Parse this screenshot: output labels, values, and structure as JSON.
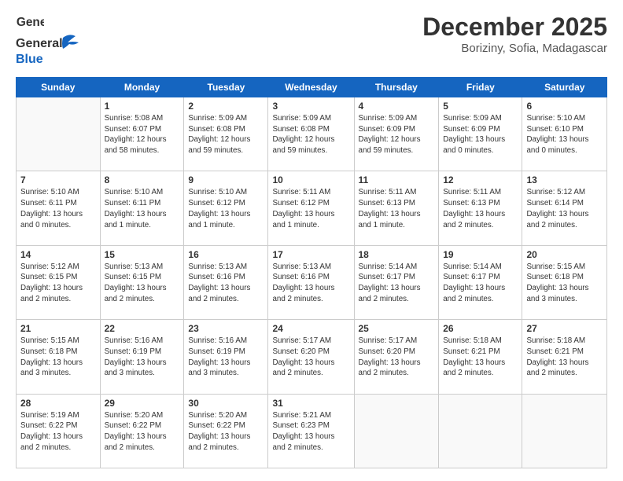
{
  "logo": {
    "line1": "General",
    "line2": "Blue"
  },
  "title": "December 2025",
  "subtitle": "Boriziny, Sofia, Madagascar",
  "days_header": [
    "Sunday",
    "Monday",
    "Tuesday",
    "Wednesday",
    "Thursday",
    "Friday",
    "Saturday"
  ],
  "weeks": [
    [
      {
        "day": "",
        "info": ""
      },
      {
        "day": "1",
        "info": "Sunrise: 5:08 AM\nSunset: 6:07 PM\nDaylight: 12 hours\nand 58 minutes."
      },
      {
        "day": "2",
        "info": "Sunrise: 5:09 AM\nSunset: 6:08 PM\nDaylight: 12 hours\nand 59 minutes."
      },
      {
        "day": "3",
        "info": "Sunrise: 5:09 AM\nSunset: 6:08 PM\nDaylight: 12 hours\nand 59 minutes."
      },
      {
        "day": "4",
        "info": "Sunrise: 5:09 AM\nSunset: 6:09 PM\nDaylight: 12 hours\nand 59 minutes."
      },
      {
        "day": "5",
        "info": "Sunrise: 5:09 AM\nSunset: 6:09 PM\nDaylight: 13 hours\nand 0 minutes."
      },
      {
        "day": "6",
        "info": "Sunrise: 5:10 AM\nSunset: 6:10 PM\nDaylight: 13 hours\nand 0 minutes."
      }
    ],
    [
      {
        "day": "7",
        "info": "Sunrise: 5:10 AM\nSunset: 6:11 PM\nDaylight: 13 hours\nand 0 minutes."
      },
      {
        "day": "8",
        "info": "Sunrise: 5:10 AM\nSunset: 6:11 PM\nDaylight: 13 hours\nand 1 minute."
      },
      {
        "day": "9",
        "info": "Sunrise: 5:10 AM\nSunset: 6:12 PM\nDaylight: 13 hours\nand 1 minute."
      },
      {
        "day": "10",
        "info": "Sunrise: 5:11 AM\nSunset: 6:12 PM\nDaylight: 13 hours\nand 1 minute."
      },
      {
        "day": "11",
        "info": "Sunrise: 5:11 AM\nSunset: 6:13 PM\nDaylight: 13 hours\nand 1 minute."
      },
      {
        "day": "12",
        "info": "Sunrise: 5:11 AM\nSunset: 6:13 PM\nDaylight: 13 hours\nand 2 minutes."
      },
      {
        "day": "13",
        "info": "Sunrise: 5:12 AM\nSunset: 6:14 PM\nDaylight: 13 hours\nand 2 minutes."
      }
    ],
    [
      {
        "day": "14",
        "info": "Sunrise: 5:12 AM\nSunset: 6:15 PM\nDaylight: 13 hours\nand 2 minutes."
      },
      {
        "day": "15",
        "info": "Sunrise: 5:13 AM\nSunset: 6:15 PM\nDaylight: 13 hours\nand 2 minutes."
      },
      {
        "day": "16",
        "info": "Sunrise: 5:13 AM\nSunset: 6:16 PM\nDaylight: 13 hours\nand 2 minutes."
      },
      {
        "day": "17",
        "info": "Sunrise: 5:13 AM\nSunset: 6:16 PM\nDaylight: 13 hours\nand 2 minutes."
      },
      {
        "day": "18",
        "info": "Sunrise: 5:14 AM\nSunset: 6:17 PM\nDaylight: 13 hours\nand 2 minutes."
      },
      {
        "day": "19",
        "info": "Sunrise: 5:14 AM\nSunset: 6:17 PM\nDaylight: 13 hours\nand 2 minutes."
      },
      {
        "day": "20",
        "info": "Sunrise: 5:15 AM\nSunset: 6:18 PM\nDaylight: 13 hours\nand 3 minutes."
      }
    ],
    [
      {
        "day": "21",
        "info": "Sunrise: 5:15 AM\nSunset: 6:18 PM\nDaylight: 13 hours\nand 3 minutes."
      },
      {
        "day": "22",
        "info": "Sunrise: 5:16 AM\nSunset: 6:19 PM\nDaylight: 13 hours\nand 3 minutes."
      },
      {
        "day": "23",
        "info": "Sunrise: 5:16 AM\nSunset: 6:19 PM\nDaylight: 13 hours\nand 3 minutes."
      },
      {
        "day": "24",
        "info": "Sunrise: 5:17 AM\nSunset: 6:20 PM\nDaylight: 13 hours\nand 2 minutes."
      },
      {
        "day": "25",
        "info": "Sunrise: 5:17 AM\nSunset: 6:20 PM\nDaylight: 13 hours\nand 2 minutes."
      },
      {
        "day": "26",
        "info": "Sunrise: 5:18 AM\nSunset: 6:21 PM\nDaylight: 13 hours\nand 2 minutes."
      },
      {
        "day": "27",
        "info": "Sunrise: 5:18 AM\nSunset: 6:21 PM\nDaylight: 13 hours\nand 2 minutes."
      }
    ],
    [
      {
        "day": "28",
        "info": "Sunrise: 5:19 AM\nSunset: 6:22 PM\nDaylight: 13 hours\nand 2 minutes."
      },
      {
        "day": "29",
        "info": "Sunrise: 5:20 AM\nSunset: 6:22 PM\nDaylight: 13 hours\nand 2 minutes."
      },
      {
        "day": "30",
        "info": "Sunrise: 5:20 AM\nSunset: 6:22 PM\nDaylight: 13 hours\nand 2 minutes."
      },
      {
        "day": "31",
        "info": "Sunrise: 5:21 AM\nSunset: 6:23 PM\nDaylight: 13 hours\nand 2 minutes."
      },
      {
        "day": "",
        "info": ""
      },
      {
        "day": "",
        "info": ""
      },
      {
        "day": "",
        "info": ""
      }
    ]
  ]
}
